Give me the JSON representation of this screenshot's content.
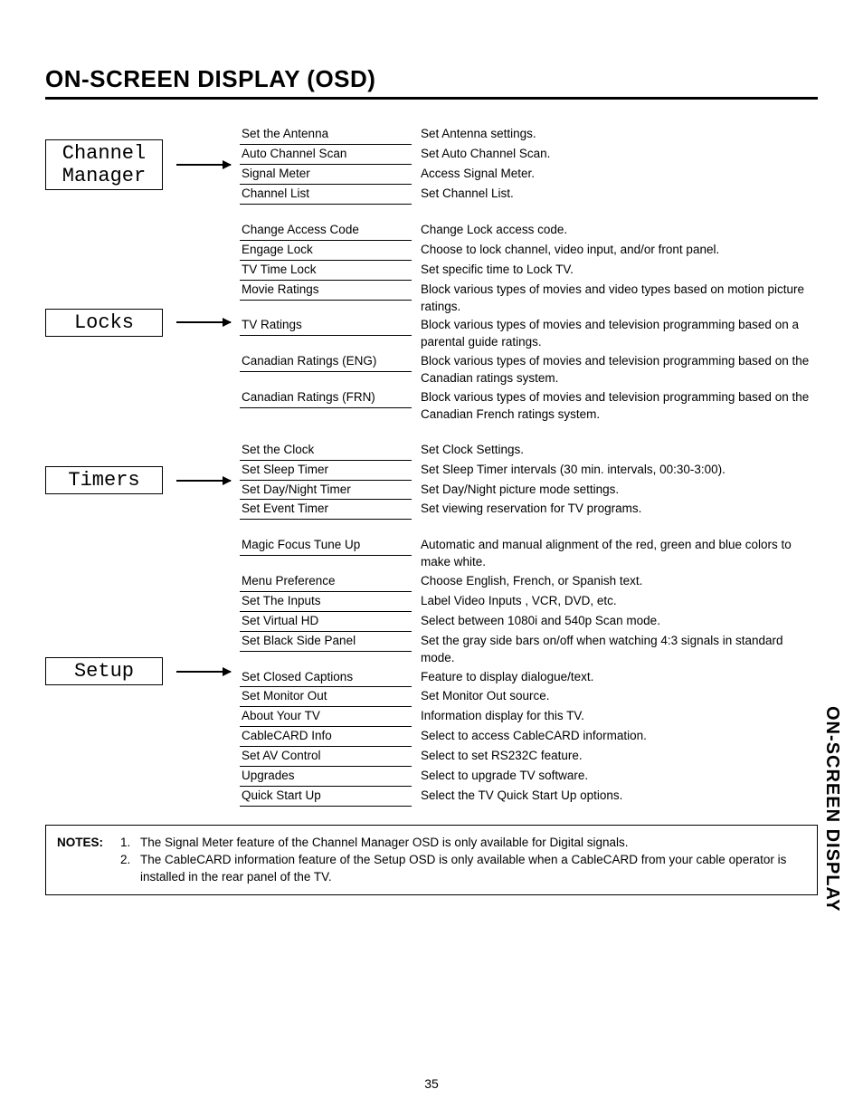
{
  "title": "ON-SCREEN DISPLAY (OSD)",
  "sideTab": "ON-SCREEN DISPLAY",
  "pageNumber": "35",
  "sections": [
    {
      "category": "Channel\nManager",
      "rows": [
        {
          "label": "Set the Antenna",
          "desc": "Set Antenna settings."
        },
        {
          "label": "Auto Channel Scan",
          "desc": "Set Auto Channel Scan."
        },
        {
          "label": "Signal Meter",
          "desc": "Access Signal Meter."
        },
        {
          "label": "Channel List",
          "desc": "Set Channel List."
        }
      ]
    },
    {
      "category": "Locks",
      "rows": [
        {
          "label": "Change Access Code",
          "desc": "Change Lock access code."
        },
        {
          "label": "Engage Lock",
          "desc": "Choose to lock channel, video input, and/or front panel."
        },
        {
          "label": "TV Time Lock",
          "desc": "Set specific time to Lock TV."
        },
        {
          "label": "Movie Ratings",
          "desc": "Block various types of movies and video types based on motion picture ratings."
        },
        {
          "label": "TV Ratings",
          "desc": "Block various types of movies and television programming based on a parental guide ratings."
        },
        {
          "label": "Canadian Ratings (ENG)",
          "desc": "Block various types of movies and television programming based on the Canadian ratings system."
        },
        {
          "label": "Canadian Ratings (FRN)",
          "desc": "Block various types of movies and television programming based on the Canadian French ratings system."
        }
      ]
    },
    {
      "category": "Timers",
      "rows": [
        {
          "label": "Set the Clock",
          "desc": "Set Clock Settings."
        },
        {
          "label": "Set Sleep Timer",
          "desc": "Set Sleep Timer intervals (30 min. intervals, 00:30-3:00)."
        },
        {
          "label": "Set Day/Night Timer",
          "desc": "Set Day/Night picture mode settings."
        },
        {
          "label": "Set Event Timer",
          "desc": "Set viewing reservation for TV programs."
        }
      ]
    },
    {
      "category": "Setup",
      "rows": [
        {
          "label": "Magic Focus Tune Up",
          "desc": "Automatic and manual alignment of the red, green and blue colors to make white."
        },
        {
          "label": "Menu Preference",
          "desc": "Choose English, French, or Spanish text."
        },
        {
          "label": "Set The Inputs",
          "desc": "Label Video Inputs , VCR, DVD, etc."
        },
        {
          "label": "Set Virtual HD",
          "desc": "Select between 1080i and 540p Scan mode."
        },
        {
          "label": "Set Black Side Panel",
          "desc": "Set the gray side bars on/off when watching 4:3 signals in standard mode."
        },
        {
          "label": "Set Closed Captions",
          "desc": "Feature to display dialogue/text."
        },
        {
          "label": "Set Monitor Out",
          "desc": "Set Monitor Out source."
        },
        {
          "label": "About Your TV",
          "desc": "Information display for this TV."
        },
        {
          "label": "CableCARD Info",
          "desc": "Select to access CableCARD information."
        },
        {
          "label": "Set AV Control",
          "desc": "Select to set RS232C feature."
        },
        {
          "label": "Upgrades",
          "desc": "Select to upgrade TV software."
        },
        {
          "label": "Quick Start Up",
          "desc": "Select the TV Quick Start Up options."
        }
      ]
    }
  ],
  "notes": {
    "label": "NOTES:",
    "items": [
      {
        "num": "1.",
        "text": "The Signal Meter feature of the Channel Manager OSD is only available for Digital signals."
      },
      {
        "num": "2.",
        "text": "The CableCARD information feature of the Setup OSD is only available when a CableCARD from your cable operator is installed in the rear panel of the TV."
      }
    ]
  }
}
